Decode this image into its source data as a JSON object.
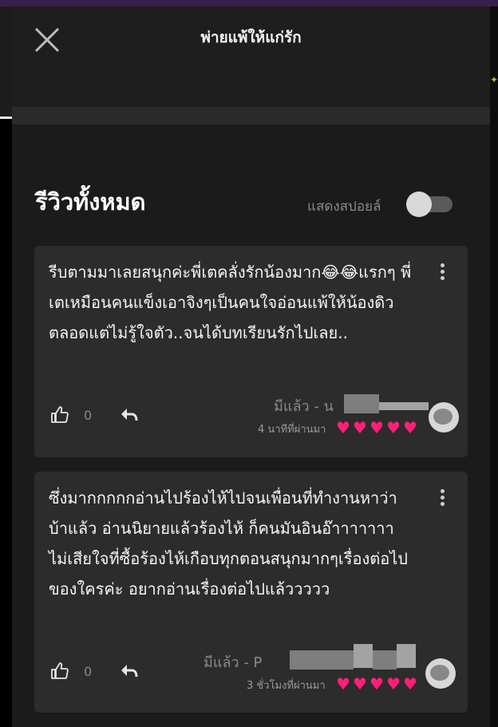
{
  "header": {
    "title": "พ่ายแพ้ให้แก่รัก",
    "close_icon": "close-icon"
  },
  "reviews_section": {
    "title": "รีวิวทั้งหมด",
    "spoiler_label": "แสดงสปอยล์",
    "spoiler_toggle_on": false
  },
  "reviews": [
    {
      "text": "รีบตามมาเลยสนุกค่ะพี่เตคลั่งรักน้องมาก😂😂แรกๆ พี่เตเหมือนคนแข็งเอาจิงๆเป็นคนใจอ่อนแพ้ให้น้องดิวตลอดแต่ไม่รู้ใจตัว..จนได้บทเรียนรักไปเลย..",
      "likes": "0",
      "author": "มีแล้ว - น",
      "time": "4 นาทีที่ผ่านมา",
      "hearts": 5
    },
    {
      "text": "ซึ่งมากกกกกอ่านไปร้องไห้ไปจนเพื่อนที่ทำงานหาว่าบ้าแล้ว อ่านนิยายแล้วร้องไห้ ก็คนมันอินอ๊าาาาาาา ไม่เสียใจที่ซื้อร้องไห้เกือบทุกตอนสนุกมากๆเรื่องต่อไปของใครค่ะ อยากอ่านเรื่องต่อไปแล้ววววว",
      "likes": "0",
      "author": "มีแล้ว - P",
      "time": "3 ชั่วโมงที่ผ่านมา",
      "hearts": 5
    }
  ],
  "colors": {
    "background": "#1b1b1b",
    "card": "#2c2c2c",
    "heart": "#ff1f7a",
    "muted_text": "#8a8a8a"
  }
}
